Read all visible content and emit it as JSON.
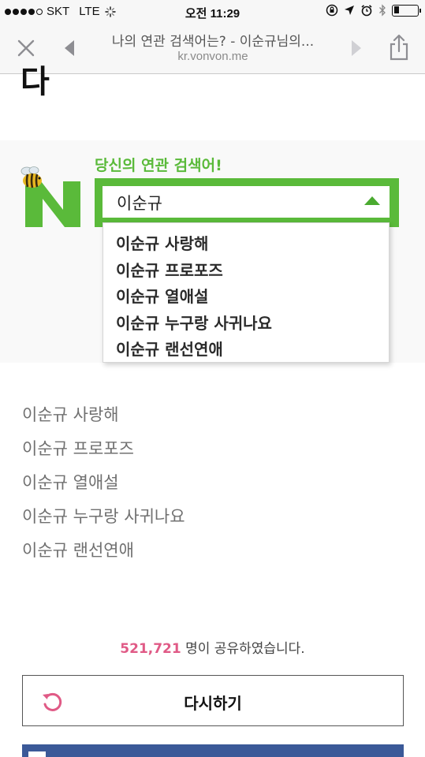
{
  "status_bar": {
    "carrier": "SKT",
    "network": "LTE",
    "time": "오전 11:29",
    "signal_filled": 4,
    "signal_total": 5,
    "battery_level": 0.2
  },
  "browser": {
    "page_title": "나의 연관 검색어는? - 이순규님의...",
    "host": "kr.vonvon.me"
  },
  "page": {
    "cut_heading": "다",
    "banner": {
      "tagline": "당신의 연관 검색어!",
      "search_value": "이순규",
      "suggestions": [
        "이순규 사랑해",
        "이순규 프로포즈",
        "이순규 열애설",
        "이순규 누구랑 사귀나요",
        "이순규 랜선연애"
      ]
    },
    "results": [
      "이순규 사랑해",
      "이순규 프로포즈",
      "이순규 열애설",
      "이순규 누구랑 사귀나요",
      "이순규 랜선연애"
    ],
    "share_count": "521,721",
    "share_suffix": " 명이 공유하였습니다.",
    "retry_label": "다시하기"
  },
  "colors": {
    "brand_green": "#5aba3a",
    "share_pink": "#e05a86",
    "facebook_blue": "#3b5998"
  }
}
